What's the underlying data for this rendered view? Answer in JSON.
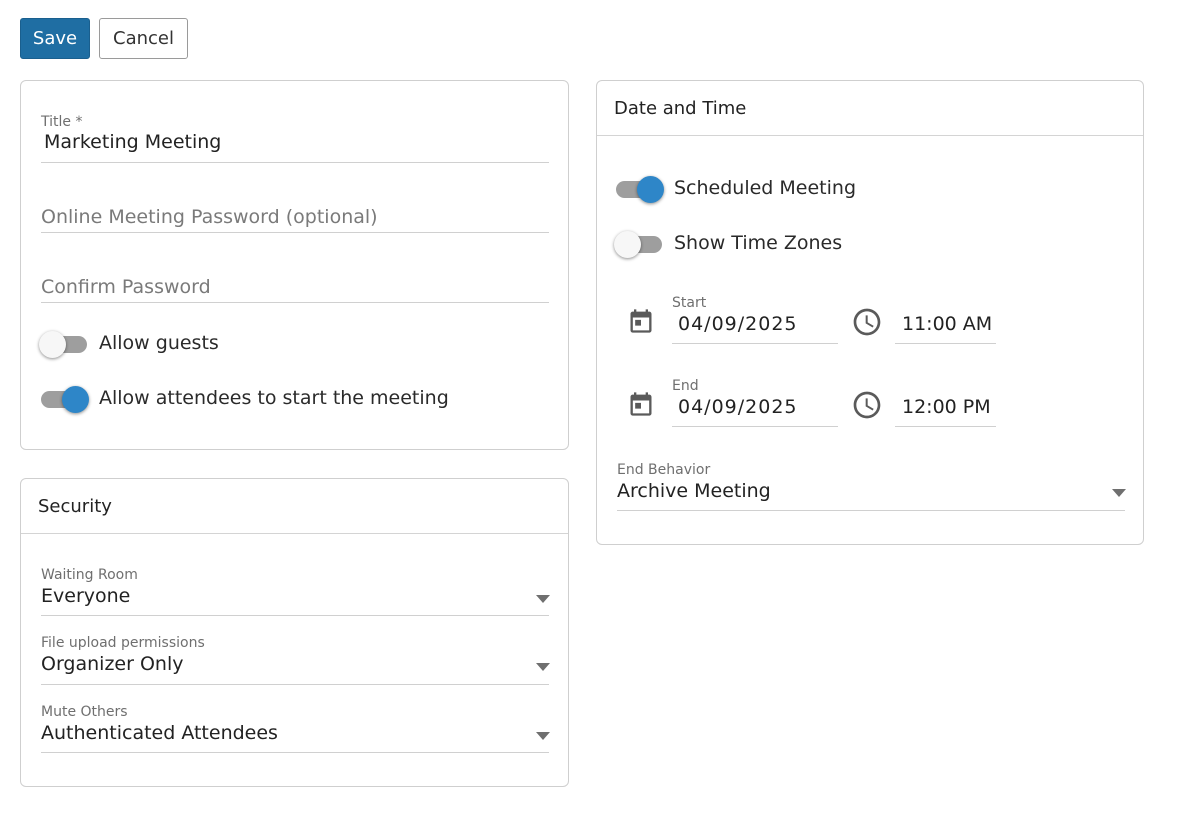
{
  "toolbar": {
    "save_label": "Save",
    "cancel_label": "Cancel"
  },
  "general": {
    "title_label": "Title *",
    "title_value": "Marketing Meeting",
    "password_placeholder": "Online Meeting Password (optional)",
    "confirm_placeholder": "Confirm Password",
    "allow_guests": {
      "label": "Allow guests",
      "on": false
    },
    "allow_attendees_start": {
      "label": "Allow attendees to start the meeting",
      "on": true
    }
  },
  "security": {
    "header": "Security",
    "waiting_room": {
      "label": "Waiting Room",
      "value": "Everyone"
    },
    "file_upload": {
      "label": "File upload permissions",
      "value": "Organizer Only"
    },
    "mute_others": {
      "label": "Mute Others",
      "value": "Authenticated Attendees"
    }
  },
  "datetime": {
    "header": "Date and Time",
    "scheduled_meeting": {
      "label": "Scheduled Meeting",
      "on": true
    },
    "show_time_zones": {
      "label": "Show Time Zones",
      "on": false
    },
    "start": {
      "label": "Start",
      "date": "04/09/2025",
      "time": "11:00 AM"
    },
    "end": {
      "label": "End",
      "date": "04/09/2025",
      "time": "12:00 PM"
    },
    "end_behavior": {
      "label": "End Behavior",
      "value": "Archive Meeting"
    }
  },
  "icons": {
    "calendar": "calendar-icon",
    "clock": "clock-icon",
    "dropdown": "caret-down-icon"
  },
  "colors": {
    "primary": "#1f6ea3",
    "toggle_on": "#2e86c8",
    "toggle_track": "#9e9e9e"
  }
}
